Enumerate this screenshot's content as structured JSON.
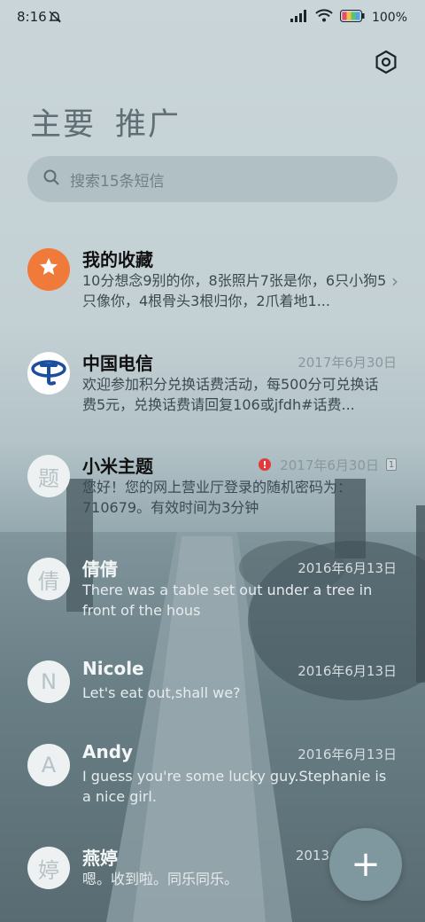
{
  "status": {
    "time": "8:16",
    "battery": "100%"
  },
  "tabs": [
    "主要",
    "推广"
  ],
  "search": {
    "placeholder": "搜索15条短信"
  },
  "conversations": [
    {
      "avatar_icon": "star-icon",
      "name": "我的收藏",
      "date": "",
      "preview": "10分想念9别的你，8张照片7张是你，6只小狗5只像你，4根骨头3根归你，2爪着地1..."
    },
    {
      "avatar_icon": "china-telecom-logo",
      "name": "中国电信",
      "date": "2017年6月30日",
      "preview": "欢迎参加积分兑换话费活动，每500分可兑换话费5元，兑换话费请回复106或jfdh#话费..."
    },
    {
      "avatar_text": "题",
      "name": "小米主题",
      "date": "2017年6月30日",
      "warning": "!",
      "sim_badge": "1",
      "preview": "您好！您的网上营业厅登录的随机密码为：710679。有效时间为3分钟"
    },
    {
      "avatar_text": "倩",
      "name": "倩倩",
      "date": "2016年6月13日",
      "preview": "There was a table set out under a tree in front of the hous"
    },
    {
      "avatar_text": "N",
      "name": "Nicole",
      "date": "2016年6月13日",
      "preview": "Let's eat out,shall we?"
    },
    {
      "avatar_text": "A",
      "name": "Andy",
      "date": "2016年6月13日",
      "preview": "I guess you're some lucky guy.Stephanie is a nice girl."
    },
    {
      "avatar_text": "婷",
      "name": "燕婷",
      "date": "2013",
      "preview": "嗯。收到啦。同乐同乐。"
    }
  ],
  "fab": {
    "icon": "plus-icon",
    "label": "+"
  },
  "colors": {
    "star_avatar": "#f07a3a",
    "telecom_blue": "#1a4fa0",
    "warning_red": "#e23b3b",
    "fab": "#7f979e"
  }
}
